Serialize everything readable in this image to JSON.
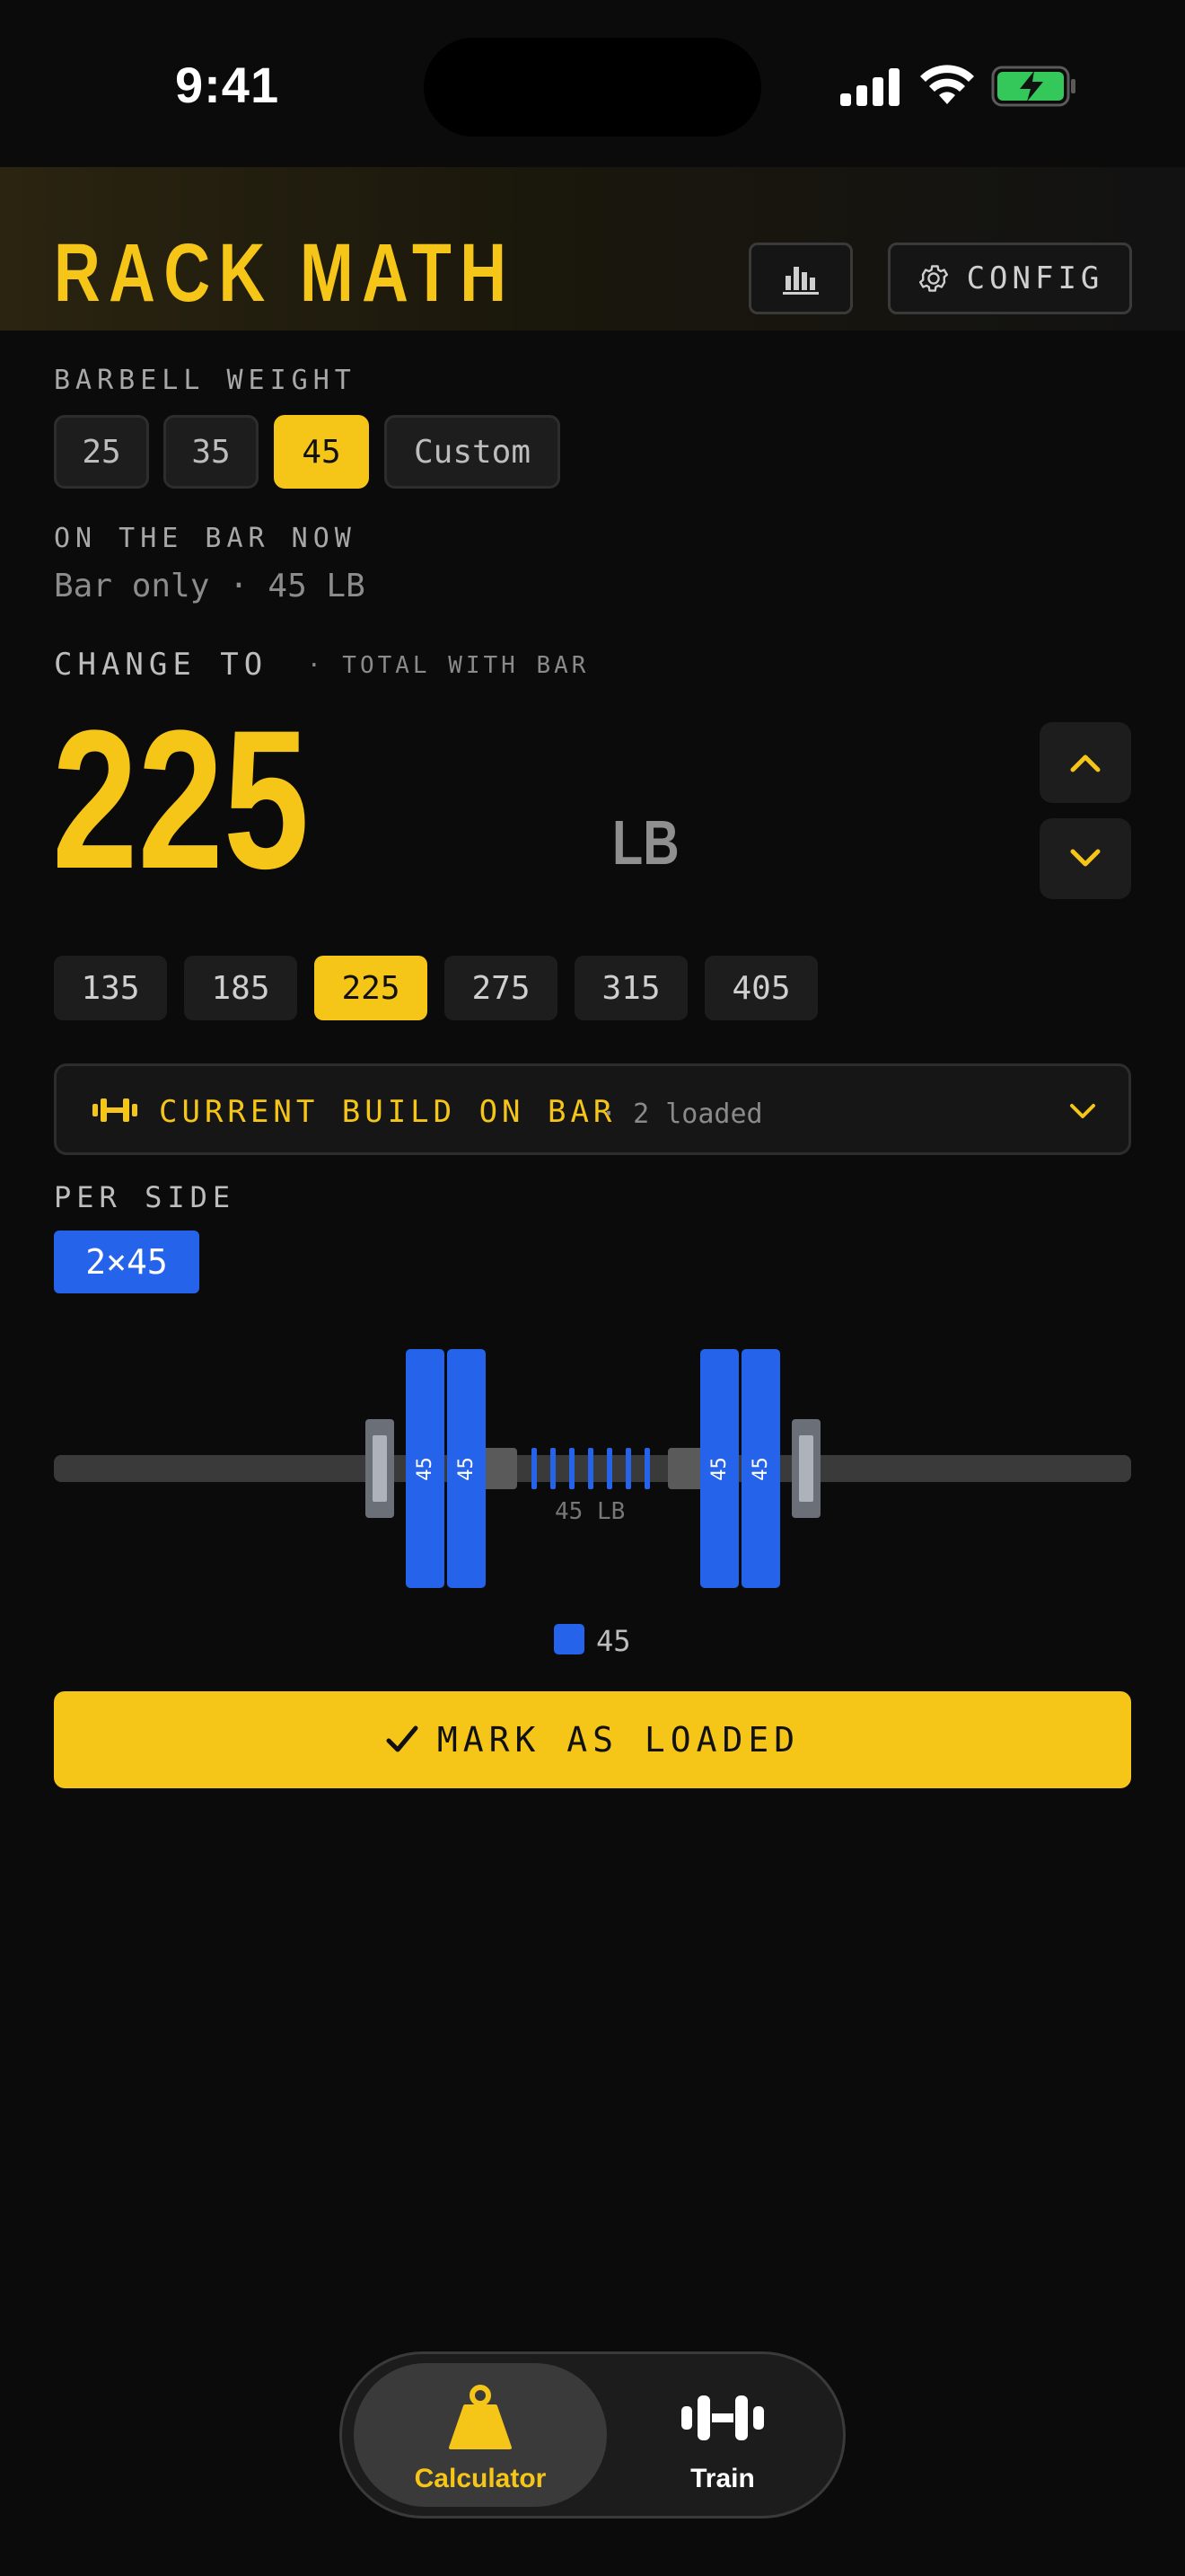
{
  "status_bar": {
    "time": "9:41"
  },
  "header": {
    "title": "RACK MATH",
    "config_label": "CONFIG",
    "stats_icon": "bar-chart-icon",
    "config_icon": "gear-icon"
  },
  "barbell": {
    "label": "BARBELL WEIGHT",
    "options": [
      "25",
      "35",
      "45",
      "Custom"
    ],
    "selected": "45"
  },
  "on_bar": {
    "label": "ON THE BAR NOW",
    "value": "Bar only · 45 LB"
  },
  "change_to": {
    "label": "CHANGE TO",
    "sublabel": "· TOTAL WITH BAR",
    "value": "225",
    "unit": "LB"
  },
  "presets": {
    "values": [
      "135",
      "185",
      "225",
      "275",
      "315",
      "405"
    ],
    "selected": "225"
  },
  "build": {
    "title": "CURRENT BUILD ON BAR",
    "count": "· 2 loaded"
  },
  "per_side": {
    "label": "PER SIDE",
    "value": "2×45"
  },
  "bar_visual": {
    "left_plates": [
      "45",
      "45"
    ],
    "right_plates": [
      "45",
      "45"
    ],
    "bar_label": "45 LB",
    "legend": "45",
    "plate_color": "#2563eb"
  },
  "action": {
    "label": "MARK AS LOADED"
  },
  "tabs": [
    {
      "label": "Calculator",
      "icon": "kettlebell-icon",
      "active": true
    },
    {
      "label": "Train",
      "icon": "dumbbell-icon",
      "active": false
    }
  ],
  "colors": {
    "accent": "#f5c518",
    "plate": "#2563eb",
    "background": "#0b0b0b"
  }
}
